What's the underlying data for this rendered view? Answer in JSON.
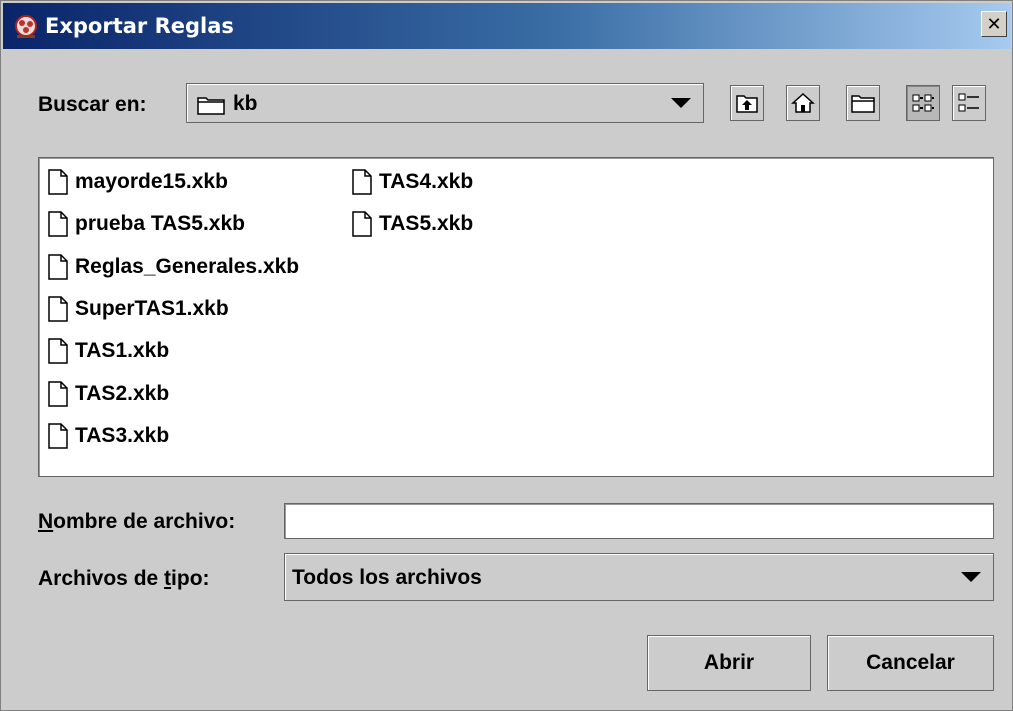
{
  "window": {
    "title": "Exportar Reglas",
    "close_symbol": "✕"
  },
  "look_in": {
    "label": "Buscar en:",
    "value": "kb",
    "icon": "folder-icon"
  },
  "toolbar": {
    "buttons": [
      {
        "name": "up-one-level-button",
        "icon": "folder-up-icon"
      },
      {
        "name": "home-button",
        "icon": "home-icon"
      },
      {
        "name": "new-folder-button",
        "icon": "new-folder-icon"
      },
      {
        "name": "list-view-button",
        "icon": "list-view-icon",
        "pressed": true
      },
      {
        "name": "details-view-button",
        "icon": "details-view-icon"
      }
    ]
  },
  "files": [
    "mayorde15.xkb",
    "prueba TAS5.xkb",
    "Reglas_Generales.xkb",
    "SuperTAS1.xkb",
    "TAS1.xkb",
    "TAS2.xkb",
    "TAS3.xkb",
    "TAS4.xkb",
    "TAS5.xkb"
  ],
  "file_name": {
    "label_mnemonic": "N",
    "label_rest": "ombre de archivo:",
    "value": ""
  },
  "file_type": {
    "label_before": "Archivos de ",
    "label_mnemonic": "t",
    "label_after": "ipo:",
    "value": "Todos los archivos"
  },
  "buttons": {
    "open": "Abrir",
    "cancel": "Cancelar"
  }
}
